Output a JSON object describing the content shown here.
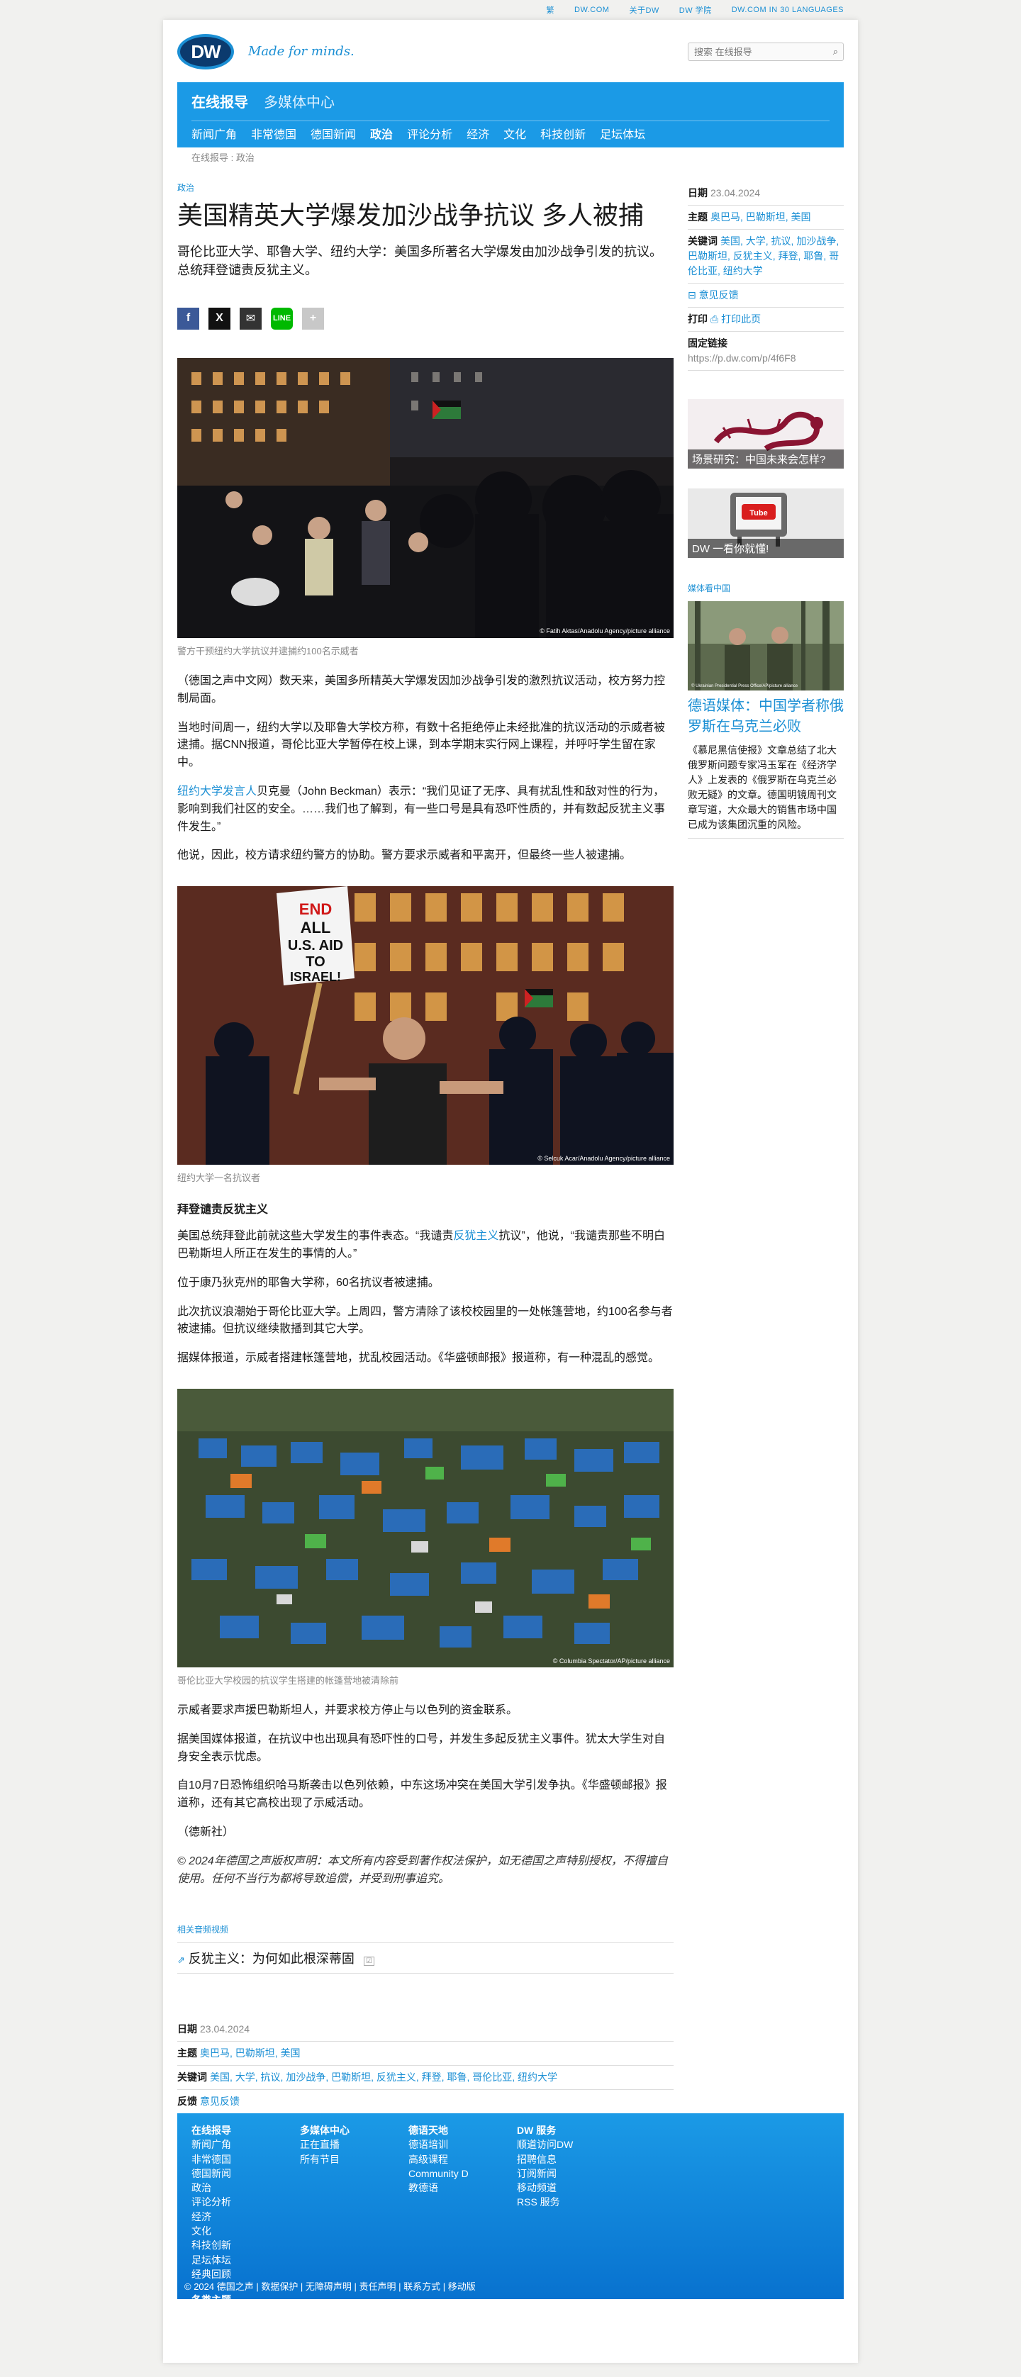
{
  "topbar": {
    "items": [
      "繁",
      "DW.COM",
      "关于DW",
      "DW 学院",
      "DW.COM IN 30 LANGUAGES"
    ]
  },
  "header": {
    "logo": "DW",
    "slogan": "Made for minds.",
    "search_placeholder": "搜索 在线报导"
  },
  "nav": {
    "primary": "在线报导",
    "secondary": "多媒体中心",
    "items": [
      "新闻广角",
      "非常德国",
      "德国新闻",
      "政治",
      "评论分析",
      "经济",
      "文化",
      "科技创新",
      "足坛体坛"
    ],
    "active_index": 3
  },
  "breadcrumb": "在线报导 : 政治",
  "article": {
    "section": "政治",
    "title": "美国精英大学爆发加沙战争抗议 多人被捕",
    "lede": "哥伦比亚大学、耶鲁大学、纽约大学：美国多所著名大学爆发由加沙战争引发的抗议。总统拜登谴责反犹主义。",
    "share": [
      "f",
      "X",
      "✉",
      "LINE",
      "+"
    ],
    "img1": {
      "caption": "警方干预纽约大学抗议并逮捕约100名示威者",
      "credit": "© Fatih Aktas/Anadolu Agency/picture alliance"
    },
    "p1": "（德国之声中文网）数天来，美国多所精英大学爆发因加沙战争引发的激烈抗议活动，校方努力控制局面。",
    "p2": "当地时间周一，纽约大学以及耶鲁大学校方称，有数十名拒绝停止未经批准的抗议活动的示威者被逮捕。据CNN报道，哥伦比亚大学暂停在校上课，到本学期末实行网上课程，并呼吁学生留在家中。",
    "p3_link": "纽约大学发言人",
    "p3_rest": "贝克曼（John Beckman）表示：“我们见证了无序、具有扰乱性和敌对性的行为，影响到我们社区的安全。……我们也了解到，有一些口号是具有恐吓性质的，并有数起反犹主义事件发生。”",
    "p4": "他说，因此，校方请求纽约警方的协助。警方要求示威者和平离开，但最终一些人被逮捕。",
    "img2": {
      "caption": "纽约大学一名抗议者",
      "credit": "© Selcuk Acar/Anadolu Agency/picture alliance"
    },
    "sub1": "拜登谴责反犹主义",
    "p5_a": "美国总统拜登此前就这些大学发生的事件表态。“我谴责",
    "p5_link": "反犹主义",
    "p5_b": "抗议”，他说，“我谴责那些不明白巴勒斯坦人所正在发生的事情的人。”",
    "p6": "位于康乃狄克州的耶鲁大学称，60名抗议者被逮捕。",
    "p7": "此次抗议浪潮始于哥伦比亚大学。上周四，警方清除了该校校园里的一处帐篷营地，约100名参与者被逮捕。但抗议继续散播到其它大学。",
    "p8": "据媒体报道，示威者搭建帐篷营地，扰乱校园活动。《华盛顿邮报》报道称，有一种混乱的感觉。",
    "img3": {
      "caption": "哥伦比亚大学校园的抗议学生搭建的帐篷营地被清除前",
      "credit": "© Columbia Spectator/AP/picture alliance"
    },
    "p9": "示威者要求声援巴勒斯坦人，并要求校方停止与以色列的资金联系。",
    "p10": "据美国媒体报道，在抗议中也出现具有恐吓性的口号，并发生多起反犹主义事件。犹太大学生对自身安全表示忧虑。",
    "p11": "自10月7日恐怖组织哈马斯袭击以色列依赖，中东这场冲突在美国大学引发争执。《华盛顿邮报》报道称，还有其它高校出现了示威活动。",
    "p12": "（德新社）",
    "copyright": "© 2024年德国之声版权声明：本文所有内容受到著作权法保护，如无德国之声特别授权，不得擅自使用。任何不当行为都将导致追偿，并受到刑事追究。",
    "related_label": "相关音频视频",
    "related_item": "反犹主义：为何如此根深蒂固",
    "related_tag": "☑"
  },
  "meta": {
    "date_label": "日期",
    "date": "23.04.2024",
    "topics_label": "主题",
    "topics": "奥巴马, 巴勒斯坦, 美国",
    "keywords_label": "关键词",
    "keywords_side": "美国, 大学, 抗议, 加沙战争, 巴勒斯坦, 反犹主义, 拜登, 耶鲁, 哥伦比亚, 纽约大学",
    "keywords": "美国, 大学, 抗议, 加沙战争, 巴勒斯坦, 反犹主义, 拜登, 耶鲁, 哥伦比亚, 纽约大学",
    "feedback_label": "反馈",
    "feedback": "意见反馈",
    "print_label": "打印",
    "print": "打印此页",
    "permalink_label": "固定链接",
    "permalink": "https://p.dw.com/p/4f6F8"
  },
  "side": {
    "teaser1": "场景研究：中国未来会怎样?",
    "teaser2": "DW 一看你就懂!",
    "media_label": "媒体看中国",
    "img_credit": "© Ukrainian Presidential Press Office/AP/picture alliance",
    "title": "德语媒体：中国学者称俄罗斯在乌克兰必败",
    "text": "《慕尼黑信使报》文章总结了北大俄罗斯问题专家冯玉军在《经济学人》上发表的《俄罗斯在乌克兰必败无疑》的文章。德国明镜周刊文章写道，大众最大的销售市场中国已成为该集团沉重的风险。"
  },
  "footer": {
    "col1": {
      "title": "在线报导",
      "items": [
        "新闻广角",
        "非常德国",
        "德国新闻",
        "政治",
        "评论分析",
        "经济",
        "文化",
        "科技创新",
        "足坛体坛",
        "经典回顾"
      ],
      "extra": "各类主题"
    },
    "col2": {
      "title": "多媒体中心",
      "items": [
        "正在直播",
        "所有节目"
      ]
    },
    "col3": {
      "title": "德语天地",
      "items": [
        "德语培训",
        "高级课程",
        "Community D",
        "教德语"
      ]
    },
    "col4": {
      "title": "DW 服务",
      "items": [
        "顺道访问DW",
        "招聘信息",
        "订阅新闻",
        "移动频道",
        "RSS 服务"
      ]
    },
    "bottom": "© 2024 德国之声 | 数据保护 | 无障碍声明 | 责任声明 | 联系方式 | 移动版"
  }
}
